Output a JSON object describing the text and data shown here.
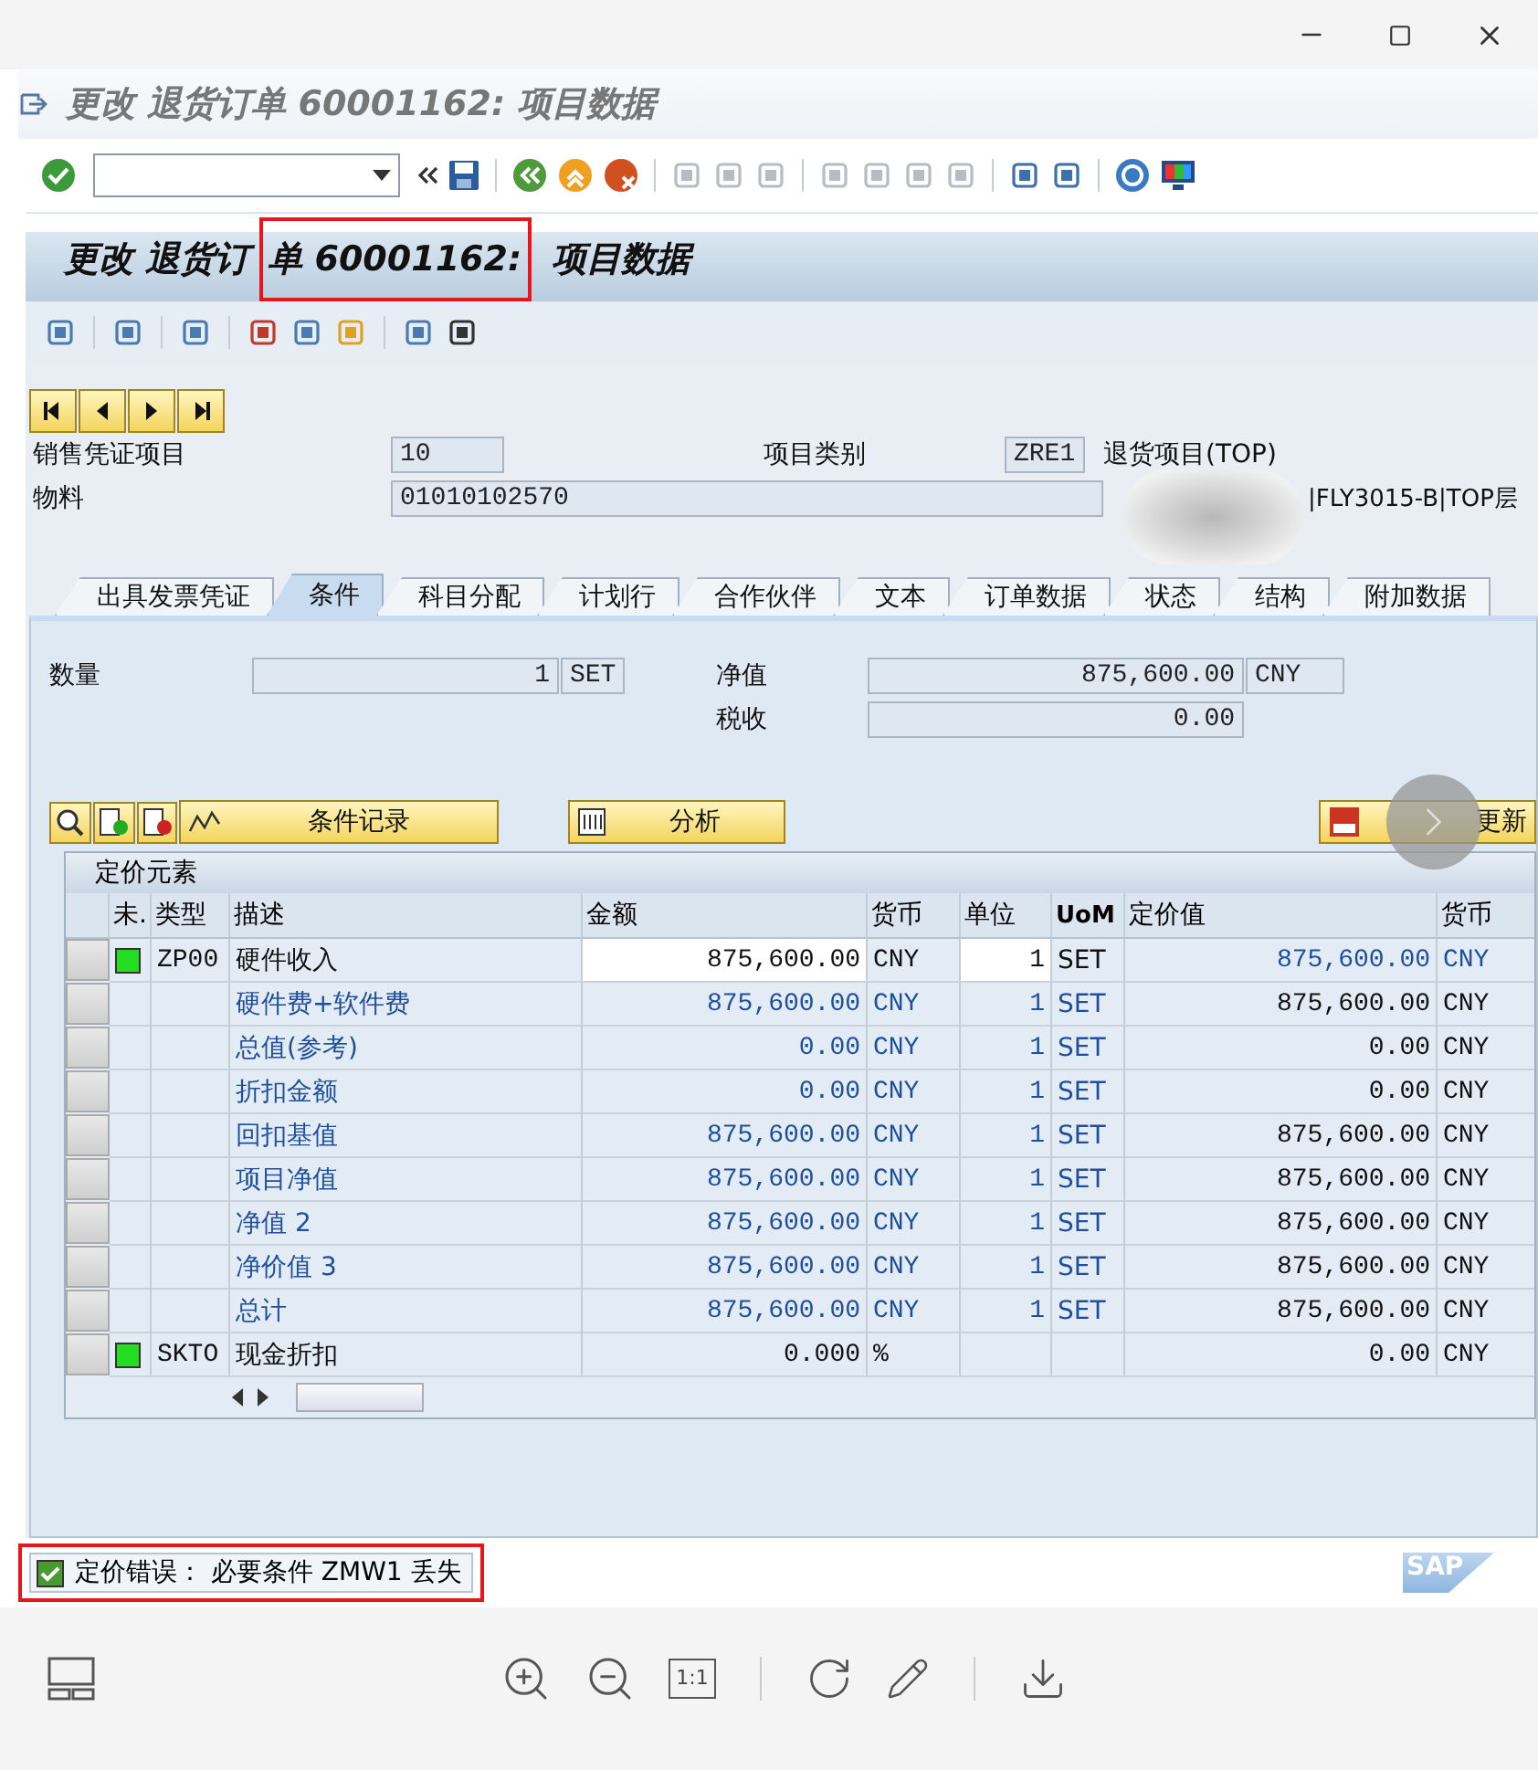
{
  "window": {
    "title": "更改 退货订单 60001162: 项目数据"
  },
  "header": {
    "title_parts": [
      {
        "text": "更改 退货订",
        "highlighted": false
      },
      {
        "text": "单 60001162:",
        "highlighted": true
      },
      {
        "text": " 项目数据",
        "highlighted": false
      }
    ]
  },
  "item": {
    "item_label": "销售凭证项目",
    "item_value": "10",
    "category_label": "项目类别",
    "category_value": "ZRE1",
    "category_text": "退货项目(TOP)",
    "material_label": "物料",
    "material_value": "01010102570",
    "material_text": "|FLY3015-B|TOP层"
  },
  "tabs": [
    {
      "label": "出具发票凭证",
      "selected": false
    },
    {
      "label": "条件",
      "selected": true
    },
    {
      "label": "科目分配",
      "selected": false
    },
    {
      "label": "计划行",
      "selected": false
    },
    {
      "label": "合作伙伴",
      "selected": false
    },
    {
      "label": "文本",
      "selected": false
    },
    {
      "label": "订单数据",
      "selected": false
    },
    {
      "label": "状态",
      "selected": false
    },
    {
      "label": "结构",
      "selected": false
    },
    {
      "label": "附加数据",
      "selected": false
    }
  ],
  "totals": {
    "quantity_label": "数量",
    "quantity": "1",
    "quantity_unit": "SET",
    "net_label": "净值",
    "net_value": "875,600.00",
    "net_currency": "CNY",
    "tax_label": "税收",
    "tax_value": "0.00"
  },
  "actions": [
    {
      "kind": "records",
      "label": "条件记录"
    },
    {
      "kind": "analysis",
      "label": "分析"
    },
    {
      "kind": "update",
      "label": "更新"
    }
  ],
  "table": {
    "title": "定价元素",
    "columns": [
      "未.",
      "类型",
      "描述",
      "金额",
      "货币",
      "单位",
      "UoM",
      "定价值",
      "货币"
    ],
    "rows": [
      {
        "kind": "condition",
        "editable": true,
        "type": "ZP00",
        "description": "硬件收入",
        "amount": "875,600.00",
        "currency": "CNY",
        "per": "1",
        "uom": "SET",
        "value": "875,600.00",
        "value_currency": "CNY"
      },
      {
        "kind": "subtotal",
        "editable": false,
        "description": "硬件费+软件费",
        "amount": "875,600.00",
        "currency": "CNY",
        "per": "1",
        "uom": "SET",
        "value": "875,600.00",
        "value_currency": "CNY"
      },
      {
        "kind": "subtotal",
        "editable": false,
        "description": "总值(参考)",
        "amount": "0.00",
        "currency": "CNY",
        "per": "1",
        "uom": "SET",
        "value": "0.00",
        "value_currency": "CNY"
      },
      {
        "kind": "subtotal",
        "editable": false,
        "description": "折扣金额",
        "amount": "0.00",
        "currency": "CNY",
        "per": "1",
        "uom": "SET",
        "value": "0.00",
        "value_currency": "CNY"
      },
      {
        "kind": "subtotal",
        "editable": false,
        "description": "回扣基值",
        "amount": "875,600.00",
        "currency": "CNY",
        "per": "1",
        "uom": "SET",
        "value": "875,600.00",
        "value_currency": "CNY"
      },
      {
        "kind": "subtotal",
        "editable": false,
        "description": "项目净值",
        "amount": "875,600.00",
        "currency": "CNY",
        "per": "1",
        "uom": "SET",
        "value": "875,600.00",
        "value_currency": "CNY"
      },
      {
        "kind": "subtotal",
        "editable": false,
        "description": "净值 2",
        "amount": "875,600.00",
        "currency": "CNY",
        "per": "1",
        "uom": "SET",
        "value": "875,600.00",
        "value_currency": "CNY"
      },
      {
        "kind": "subtotal",
        "editable": false,
        "description": "净价值 3",
        "amount": "875,600.00",
        "currency": "CNY",
        "per": "1",
        "uom": "SET",
        "value": "875,600.00",
        "value_currency": "CNY"
      },
      {
        "kind": "subtotal",
        "editable": false,
        "description": "总计",
        "amount": "875,600.00",
        "currency": "CNY",
        "per": "1",
        "uom": "SET",
        "value": "875,600.00",
        "value_currency": "CNY"
      },
      {
        "kind": "condition",
        "editable": false,
        "type": "SKTO",
        "description": "现金折扣",
        "amount": "0.000",
        "currency": "%",
        "value": "0.00",
        "value_currency": "CNY"
      }
    ]
  },
  "status": {
    "message": "定价错误： 必要条件 ZMW1 丢失"
  },
  "sap_logo": "SAP",
  "viewer": {
    "actual_size": "1:1"
  }
}
